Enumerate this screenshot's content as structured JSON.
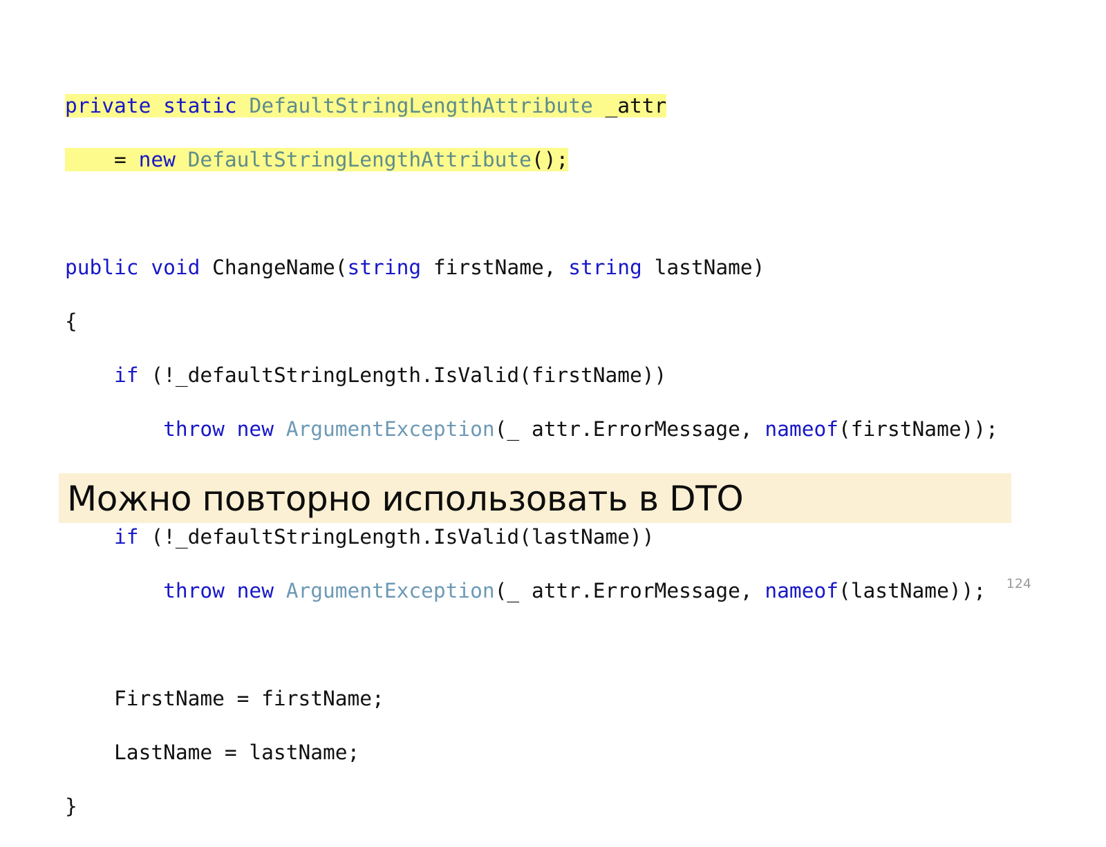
{
  "slide": {
    "page_number": "124",
    "caption": "Можно повторно использовать в DTO",
    "caption_bg": "#FBF0D3",
    "highlight_color": "#FDFB8C",
    "background": "#FFFFFF"
  },
  "colors": {
    "keyword": "#1717C8",
    "type": "#5E8C8C",
    "class_name": "#6D99B5",
    "plain": "#111111",
    "page_number": "#9A9A9A"
  },
  "code": {
    "language": "csharp",
    "full_text": "private static DefaultStringLengthAttribute _attr\n    = new DefaultStringLengthAttribute();\n\npublic void ChangeName(string firstName, string lastName)\n{\n    if (!_defaultStringLength.IsValid(firstName))\n        throw new ArgumentException(_ attr.ErrorMessage, nameof(firstName));\n\n    if (!_defaultStringLength.IsValid(lastName))\n        throw new ArgumentException(_ attr.ErrorMessage, nameof(lastName));\n\n    FirstName = firstName;\n    LastName = lastName;\n}",
    "lines": [
      {
        "id": "line-1",
        "highlighted": true,
        "tokens": [
          {
            "t": "private",
            "c": "kw"
          },
          {
            "t": " ",
            "c": "plain"
          },
          {
            "t": "static",
            "c": "kw"
          },
          {
            "t": " ",
            "c": "plain"
          },
          {
            "t": "DefaultStringLengthAttribute",
            "c": "type"
          },
          {
            "t": " _attr",
            "c": "plain"
          }
        ]
      },
      {
        "id": "line-2",
        "highlighted": true,
        "tokens": [
          {
            "t": "    = ",
            "c": "plain"
          },
          {
            "t": "new",
            "c": "kw"
          },
          {
            "t": " ",
            "c": "plain"
          },
          {
            "t": "DefaultStringLengthAttribute",
            "c": "type"
          },
          {
            "t": "();",
            "c": "plain"
          }
        ]
      },
      {
        "id": "line-3",
        "highlighted": false,
        "tokens": []
      },
      {
        "id": "line-4",
        "highlighted": false,
        "tokens": [
          {
            "t": "public",
            "c": "kw"
          },
          {
            "t": " ",
            "c": "plain"
          },
          {
            "t": "void",
            "c": "kw"
          },
          {
            "t": " ChangeName(",
            "c": "plain"
          },
          {
            "t": "string",
            "c": "kw"
          },
          {
            "t": " firstName, ",
            "c": "plain"
          },
          {
            "t": "string",
            "c": "kw"
          },
          {
            "t": " lastName)",
            "c": "plain"
          }
        ]
      },
      {
        "id": "line-5",
        "highlighted": false,
        "tokens": [
          {
            "t": "{",
            "c": "plain"
          }
        ]
      },
      {
        "id": "line-6",
        "highlighted": false,
        "tokens": [
          {
            "t": "    ",
            "c": "plain"
          },
          {
            "t": "if",
            "c": "kw"
          },
          {
            "t": " (!_defaultStringLength.IsValid(firstName))",
            "c": "plain"
          }
        ]
      },
      {
        "id": "line-7",
        "highlighted": false,
        "tokens": [
          {
            "t": "        ",
            "c": "plain"
          },
          {
            "t": "throw",
            "c": "kw"
          },
          {
            "t": " ",
            "c": "plain"
          },
          {
            "t": "new",
            "c": "kw"
          },
          {
            "t": " ",
            "c": "plain"
          },
          {
            "t": "ArgumentException",
            "c": "class"
          },
          {
            "t": "(_ attr.ErrorMessage, ",
            "c": "plain"
          },
          {
            "t": "nameof",
            "c": "kw"
          },
          {
            "t": "(firstName));",
            "c": "plain"
          }
        ]
      },
      {
        "id": "line-8",
        "highlighted": false,
        "tokens": []
      },
      {
        "id": "line-9",
        "highlighted": false,
        "tokens": [
          {
            "t": "    ",
            "c": "plain"
          },
          {
            "t": "if",
            "c": "kw"
          },
          {
            "t": " (!_defaultStringLength.IsValid(lastName))",
            "c": "plain"
          }
        ]
      },
      {
        "id": "line-10",
        "highlighted": false,
        "tokens": [
          {
            "t": "        ",
            "c": "plain"
          },
          {
            "t": "throw",
            "c": "kw"
          },
          {
            "t": " ",
            "c": "plain"
          },
          {
            "t": "new",
            "c": "kw"
          },
          {
            "t": " ",
            "c": "plain"
          },
          {
            "t": "ArgumentException",
            "c": "class"
          },
          {
            "t": "(_ attr.ErrorMessage, ",
            "c": "plain"
          },
          {
            "t": "nameof",
            "c": "kw"
          },
          {
            "t": "(lastName));",
            "c": "plain"
          }
        ]
      },
      {
        "id": "line-11",
        "highlighted": false,
        "tokens": []
      },
      {
        "id": "line-12",
        "highlighted": false,
        "tokens": [
          {
            "t": "    FirstName = firstName;",
            "c": "plain"
          }
        ]
      },
      {
        "id": "line-13",
        "highlighted": false,
        "tokens": [
          {
            "t": "    LastName = lastName;",
            "c": "plain"
          }
        ]
      },
      {
        "id": "line-14",
        "highlighted": false,
        "tokens": [
          {
            "t": "}",
            "c": "plain"
          }
        ]
      }
    ]
  }
}
